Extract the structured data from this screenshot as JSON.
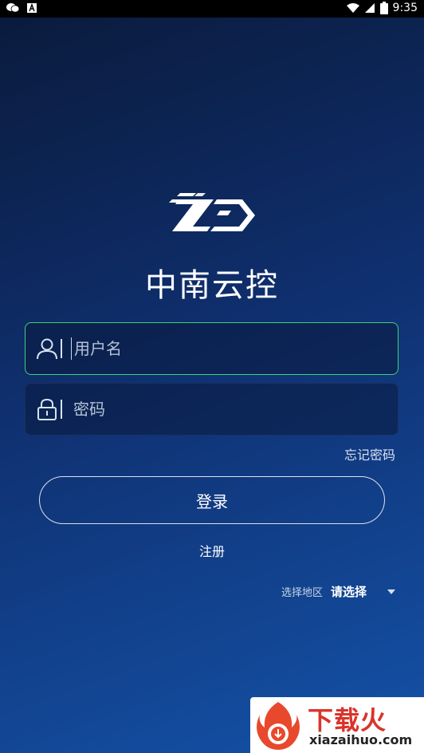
{
  "status_bar": {
    "time": "9:35",
    "left_icons": [
      "wechat-icon",
      "a-badge-icon"
    ],
    "right_icons": [
      "wifi-icon",
      "signal-icon",
      "battery-icon"
    ]
  },
  "app": {
    "title": "中南云控"
  },
  "login_form": {
    "username_placeholder": "用户名",
    "password_placeholder": "密码",
    "forgot_password": "忘记密码",
    "login_button": "登录",
    "register": "注册"
  },
  "region": {
    "label": "选择地区",
    "value": "请选择"
  },
  "watermark": {
    "brand": "下载火",
    "domain": "xiazaihuo.com"
  },
  "colors": {
    "accent_border": "#3fd07a",
    "watermark_red": "#d9342b"
  }
}
